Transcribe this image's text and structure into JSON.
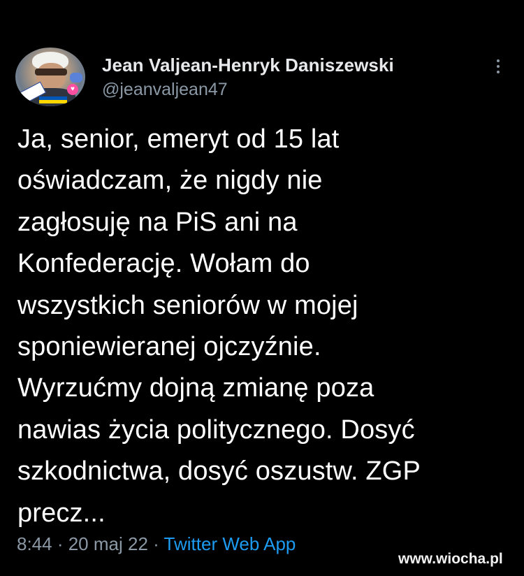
{
  "tweet": {
    "author": {
      "display_name": "Jean Valjean-Henryk Daniszewski",
      "handle": "@jeanvaljean47"
    },
    "text": "Ja, senior, emeryt od 15 lat\noświadczam, że nigdy nie\nzagłosuję na PiS ani na\nKonfederację. Wołam do\nwszystkich seniorów w mojej\nsponiewieranej ojczyźnie.\nWyrzućmy dojną zmianę poza\nnawias życia politycznego. Dosyć\nszkodnictwa, dosyć oszustw. ZGP\nprecz...",
    "time": "8:44",
    "separator": " · ",
    "date": "20 maj 22",
    "source": "Twitter Web App"
  },
  "icons": {
    "more": "more-vertical-icon"
  },
  "watermark": "www.wiocha.pl",
  "colors": {
    "background": "#000000",
    "primary_text": "#e7e9ea",
    "secondary_text": "#8b98a5",
    "link": "#1d9bf0"
  }
}
